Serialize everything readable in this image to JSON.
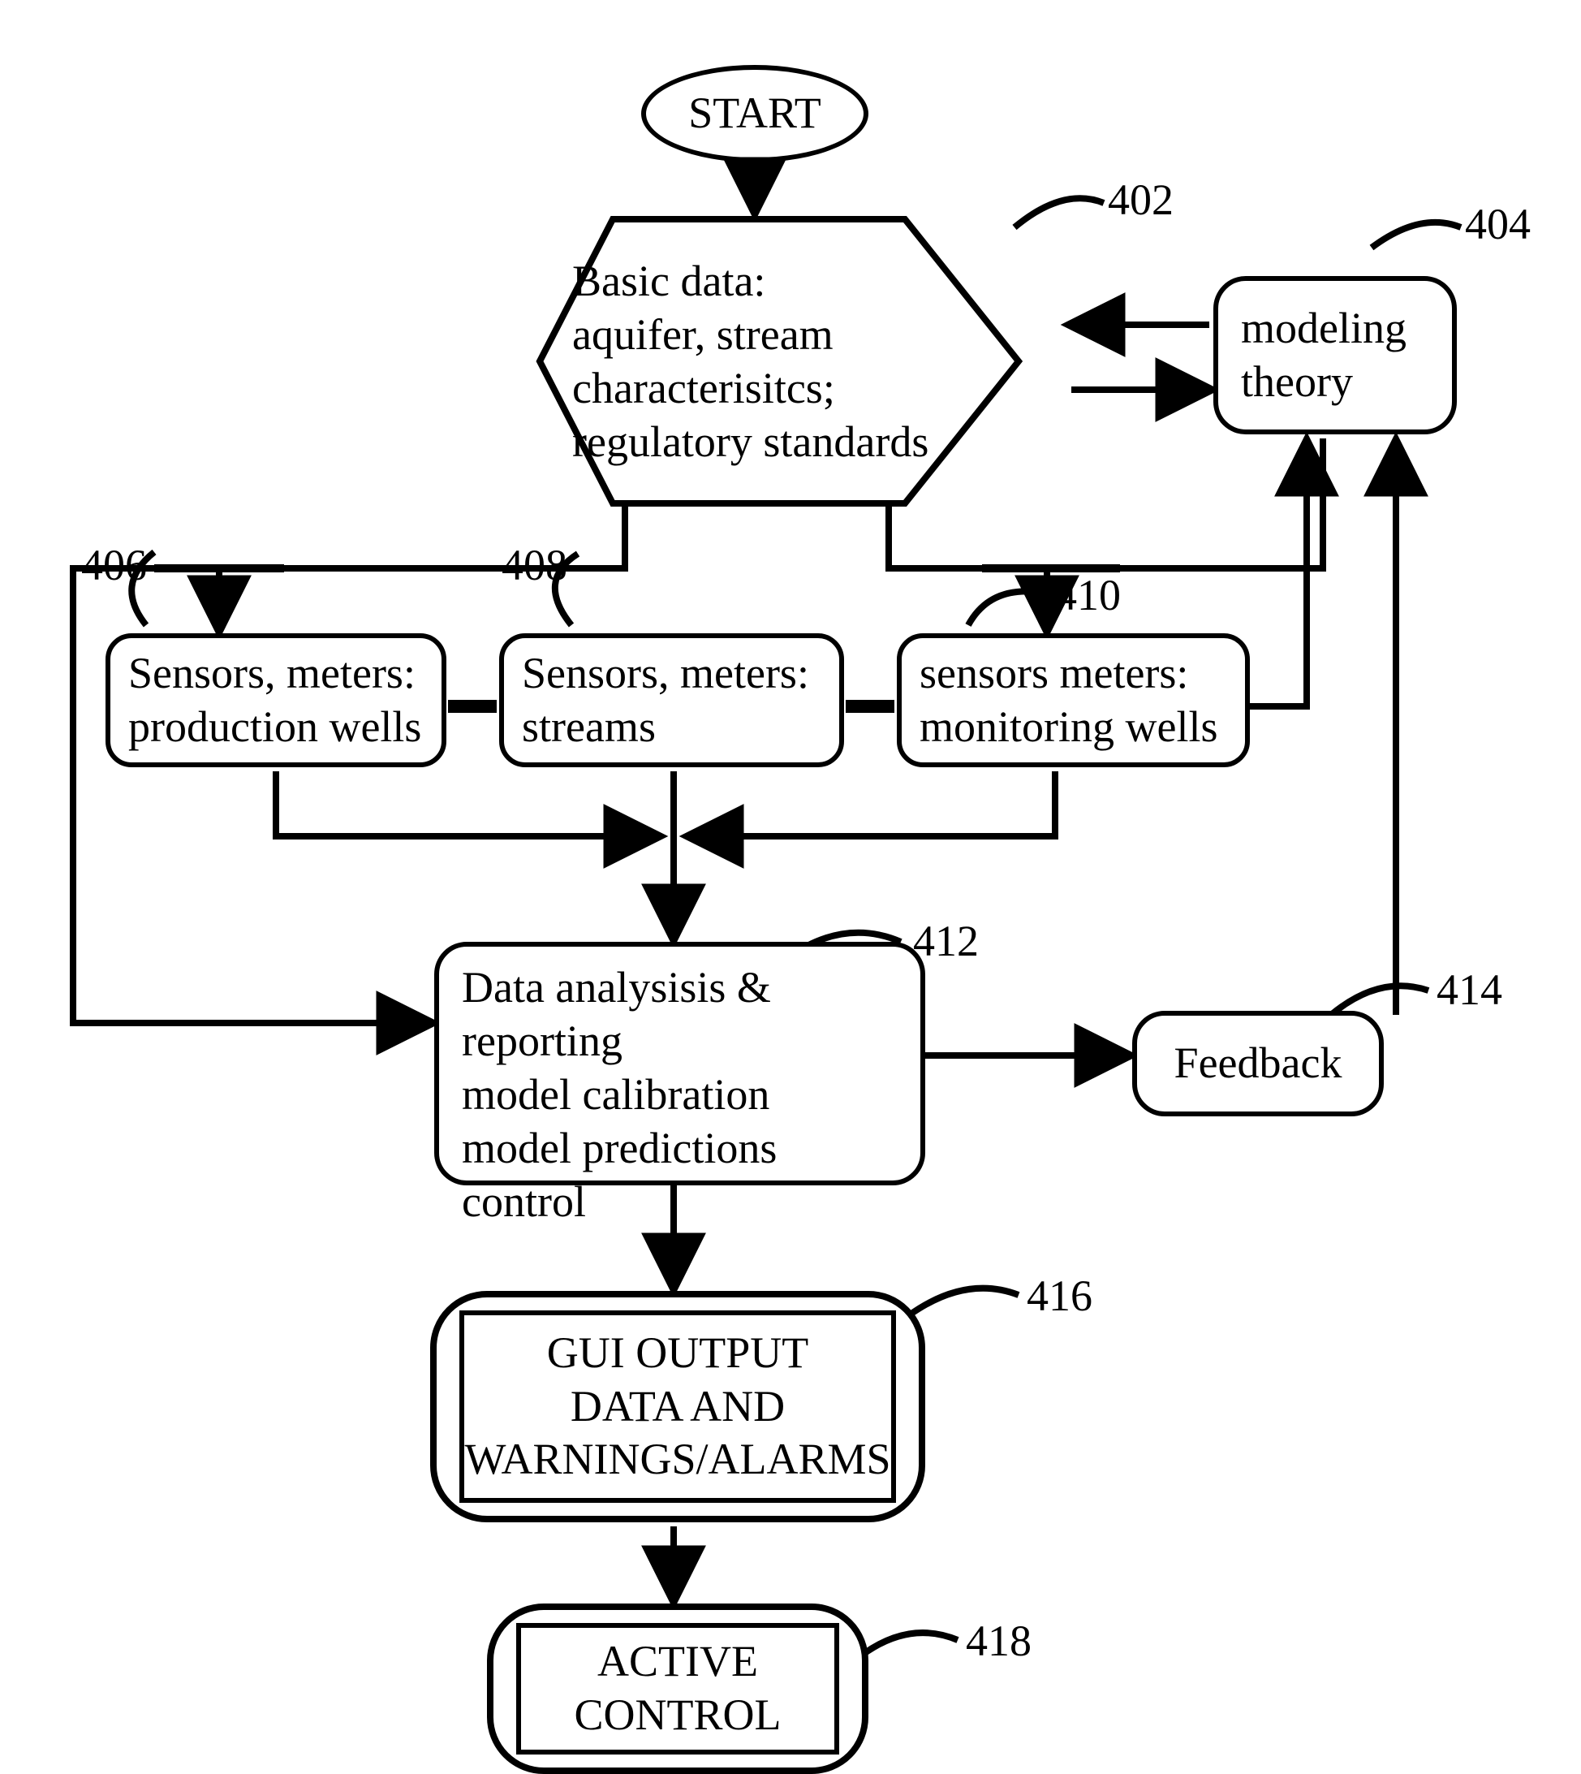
{
  "start": {
    "label": "START"
  },
  "basic_data": {
    "line1": "Basic data:",
    "line2": "aquifer, stream",
    "line3": "characterisitcs;",
    "line4": "regulatory standards"
  },
  "modeling_theory": {
    "line1": "modeling",
    "line2": "theory"
  },
  "sensors": {
    "prod": {
      "line1": "Sensors, meters:",
      "line2": "production wells"
    },
    "stream": {
      "line1": "Sensors, meters:",
      "line2": "streams"
    },
    "mon": {
      "line1": "sensors meters:",
      "line2": "monitoring wells"
    }
  },
  "analysis": {
    "line1": "Data analysisis & reporting",
    "line2": "model calibration",
    "line3": "model predictions",
    "line4": "control"
  },
  "feedback": {
    "label": "Feedback"
  },
  "gui_output": {
    "line1": "GUI OUTPUT",
    "line2": "DATA AND",
    "line3": "WARNINGS/ALARMS"
  },
  "active_control": {
    "line1": "ACTIVE",
    "line2": "CONTROL"
  },
  "refs": {
    "basic_data": "402",
    "modeling_theory": "404",
    "sensors_prod": "406",
    "sensors_stream": "408",
    "sensors_mon": "410",
    "analysis": "412",
    "feedback": "414",
    "gui_output": "416",
    "active_control": "418"
  }
}
